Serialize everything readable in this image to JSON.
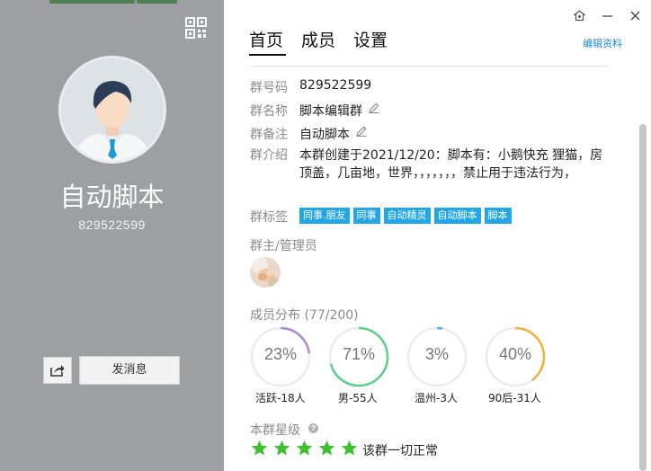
{
  "group": {
    "name": "自动脚本",
    "number": "829522599"
  },
  "left_panel": {
    "send_message_label": "发消息"
  },
  "tabs": [
    {
      "label": "首页"
    },
    {
      "label": "成员"
    },
    {
      "label": "设置"
    }
  ],
  "header": {
    "edit_label": "编辑资料"
  },
  "info": {
    "number_label": "群号码",
    "number_value": "829522599",
    "name_label": "群名称",
    "name_value": "脚本编辑群",
    "remark_label": "群备注",
    "remark_value": "自动脚本",
    "intro_label": "群介绍",
    "intro_value": "本群创建于2021/12/20：脚本有：小鹅快充 狸猫，房顶盖，几亩地，世界，，，，，，，禁止用于违法行为，",
    "tags_label": "群标签",
    "tags": [
      "同事.朋友",
      "同事",
      "自动精灵",
      "自动脚本",
      "脚本"
    ]
  },
  "admins": {
    "title": "群主/管理员"
  },
  "distribution": {
    "title": "成员分布 (77/200)",
    "stats": [
      {
        "percent": "23%",
        "value": 23,
        "caption": "活跃-18人",
        "color": "#a98ad8"
      },
      {
        "percent": "71%",
        "value": 71,
        "caption": "男-55人",
        "color": "#5ccf8a"
      },
      {
        "percent": "3%",
        "value": 3,
        "caption": "温州-3人",
        "color": "#5aa8e8"
      },
      {
        "percent": "40%",
        "value": 40,
        "caption": "90后-31人",
        "color": "#f3b13c"
      }
    ]
  },
  "rating": {
    "title": "本群星级",
    "stars": 5,
    "status": "该群一切正常",
    "star_color": "#3dbf2e"
  }
}
